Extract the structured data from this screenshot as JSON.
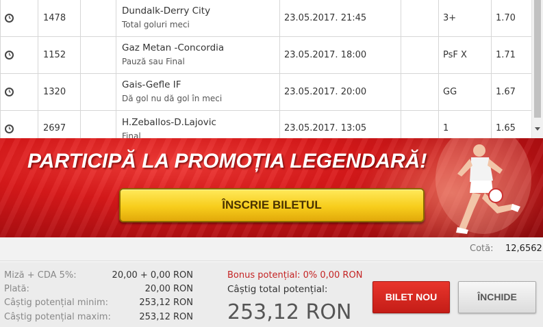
{
  "bets": [
    {
      "code": "1478",
      "match": "Dundalk-Derry City",
      "market": "Total goluri meci",
      "date": "23.05.2017. 21:45",
      "pick": "3+",
      "odd": "1.70"
    },
    {
      "code": "1152",
      "match": "Gaz Metan -Concordia",
      "market": "Pauză sau Final",
      "date": "23.05.2017. 18:00",
      "pick": "PsF X",
      "odd": "1.71"
    },
    {
      "code": "1320",
      "match": "Gais-Gefle IF",
      "market": "Dă gol nu dă gol în meci",
      "date": "23.05.2017. 20:00",
      "pick": "GG",
      "odd": "1.67"
    },
    {
      "code": "2697",
      "match": "H.Zeballos-D.Lajovic",
      "market": "Final",
      "date": "23.05.2017. 13:05",
      "pick": "1",
      "odd": "1.65"
    }
  ],
  "banner": {
    "title": "PARTICIPĂ LA PROMOȚIA LEGENDARĂ!",
    "button_label": "ÎNSCRIE BILETUL"
  },
  "odds": {
    "label": "Cotă:",
    "value": "12,6562"
  },
  "summary": {
    "rows": [
      {
        "label": "Miză + CDA 5%:",
        "value": "20,00 + 0,00 RON"
      },
      {
        "label": "Plată:",
        "value": "20,00 RON"
      },
      {
        "label": "Câștig potențial minim:",
        "value": "253,12 RON"
      },
      {
        "label": "Câștig potențial maxim:",
        "value": "253,12 RON"
      }
    ],
    "bonus": "Bonus potențial: 0% 0,00 RON",
    "total_label": "Câștig total potențial:",
    "total_value": "253,12 RON"
  },
  "buttons": {
    "new_ticket": "BILET NOU",
    "close": "ÎNCHIDE"
  },
  "colors": {
    "accent_red": "#d9191a",
    "button_yellow": "#f7cd1c",
    "bonus_red": "#c42323"
  },
  "icons": {
    "row_icon": "clock-icon"
  }
}
